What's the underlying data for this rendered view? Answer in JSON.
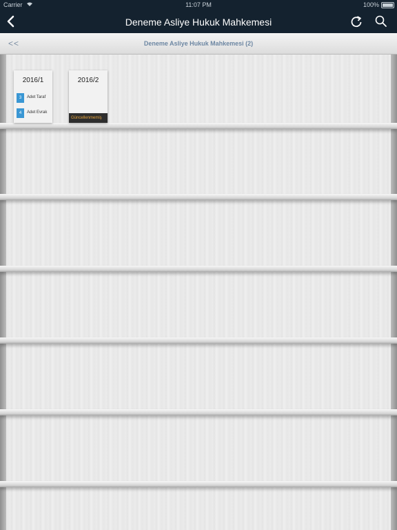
{
  "status_bar": {
    "carrier": "Carrier",
    "time": "11:07 PM",
    "battery": "100%"
  },
  "nav": {
    "title": "Deneme Asliye Hukuk Mahkemesi"
  },
  "subheader": {
    "back_label": "<<",
    "title": "Deneme Asliye Hukuk Mahkemesi (2)"
  },
  "cards": [
    {
      "title": "2016/1",
      "rows": [
        {
          "count": "3",
          "label": "Adet Taraf"
        },
        {
          "count": "4",
          "label": "Adet Evrak"
        }
      ]
    },
    {
      "title": "2016/2",
      "flag": "Güncellenmemiş"
    }
  ],
  "colors": {
    "nav_bg": "#14222f",
    "badge": "#3a97d4",
    "flag_text": "#e8a53c"
  }
}
